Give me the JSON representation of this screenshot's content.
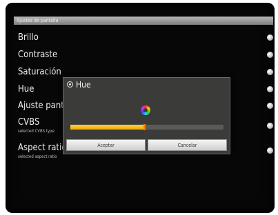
{
  "header": {
    "title": "Ajustes de pantalla"
  },
  "menu": {
    "items": [
      {
        "label": "Brillo"
      },
      {
        "label": "Contraste"
      },
      {
        "label": "Saturación"
      },
      {
        "label": "Hue"
      },
      {
        "label": "Ajuste pantall"
      },
      {
        "label": "CVBS",
        "sublabel": "selected CVBS type"
      },
      {
        "label": "Aspect ratio",
        "sublabel": "selected aspect ratio"
      }
    ]
  },
  "dialog": {
    "title": "Hue",
    "value_fraction": 0.48,
    "accept_label": "Aceptar",
    "cancel_label": "Cancelar"
  },
  "colors": {
    "accent": "#f2a900",
    "background": "#070707"
  }
}
